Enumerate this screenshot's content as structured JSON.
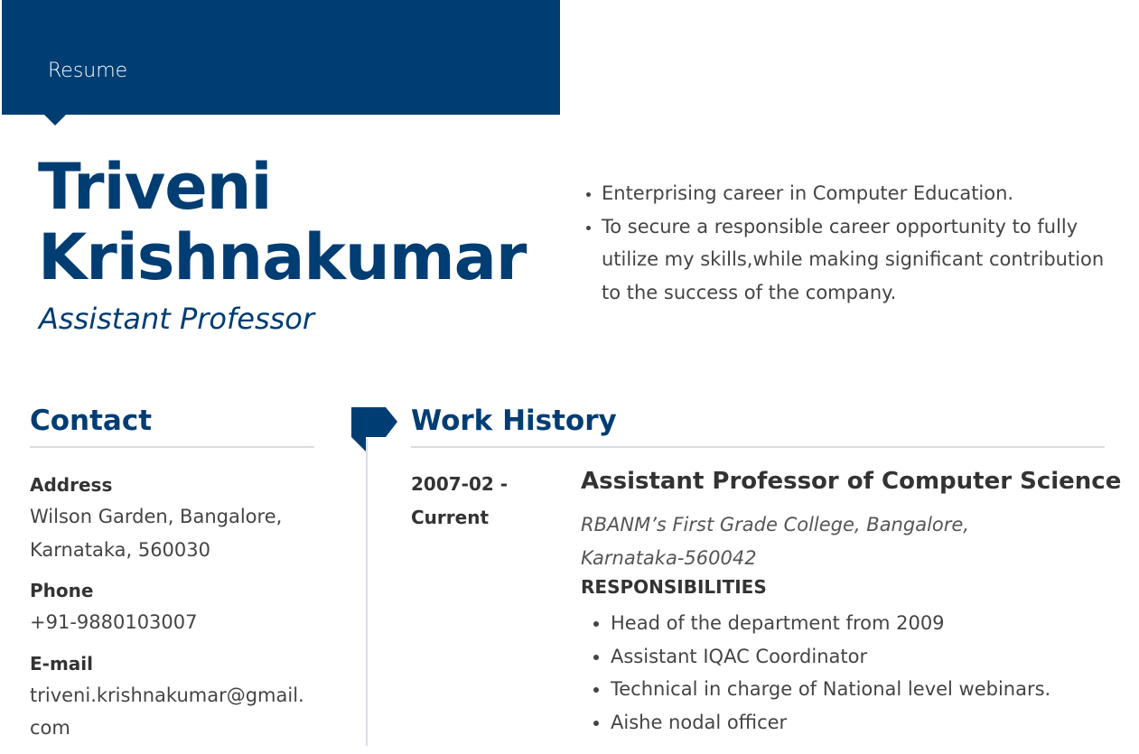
{
  "banner": {
    "label": "Resume"
  },
  "header": {
    "first_name": "Triveni",
    "last_name": "Krishnakumar",
    "title": "Assistant Professor"
  },
  "summary": [
    "Enterprising career in Computer Education.",
    "To secure a responsible career opportunity to fully utilize my skills,while making significant contribution to the success of the company."
  ],
  "contact": {
    "heading": "Contact",
    "address_label": "Address",
    "address_value": "Wilson Garden, Bangalore, Karnataka, 560030",
    "phone_label": "Phone",
    "phone_value": "+91-9880103007",
    "email_label": "E-mail",
    "email_value": "triveni.krishnakumar@gmail.com"
  },
  "work_history": {
    "heading": "Work History",
    "jobs": [
      {
        "dates": "2007-02 - Current",
        "title": "Assistant Professor of Computer Science",
        "employer": "RBANM’s First Grade College, Bangalore, Karnataka-560042",
        "responsibilities_label": "RESPONSIBILITIES",
        "responsibilities": [
          "Head of the department from 2009",
          "Assistant IQAC Coordinator",
          "Technical in charge of National level webinars.",
          "Aishe nodal officer"
        ]
      }
    ]
  },
  "colors": {
    "accent": "#003d73",
    "rule": "#d9dde3"
  }
}
